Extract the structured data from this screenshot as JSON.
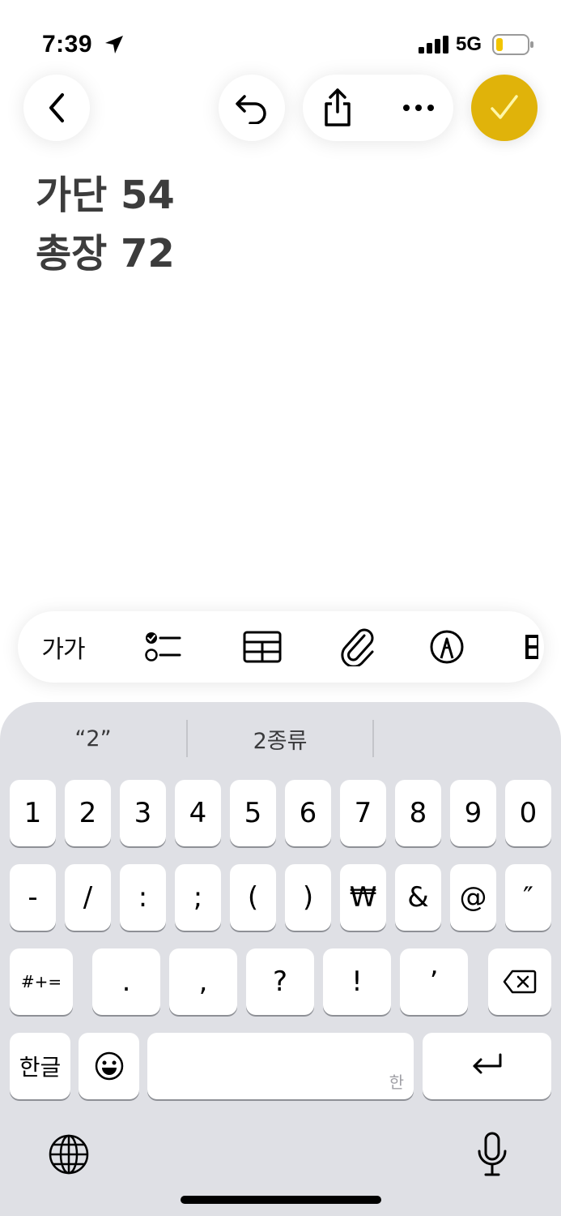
{
  "status_bar": {
    "time": "7:39",
    "network": "5G",
    "icons": [
      "location-arrow-icon",
      "signal-bars-icon",
      "battery-low-icon"
    ]
  },
  "toolbar": {
    "buttons": [
      "back-icon",
      "undo-icon",
      "share-icon",
      "more-icon",
      "checkmark-icon"
    ],
    "accent_color": "#e0b30a"
  },
  "note": {
    "lines": [
      "가단 54",
      "총장 72"
    ]
  },
  "format_bar": {
    "text_style_label": "가가",
    "icons": [
      "checklist-icon",
      "table-icon",
      "paperclip-icon",
      "markup-pen-icon",
      "partial-icon"
    ]
  },
  "keyboard": {
    "suggestions": [
      "“2”",
      "2종류",
      ""
    ],
    "row1": [
      "1",
      "2",
      "3",
      "4",
      "5",
      "6",
      "7",
      "8",
      "9",
      "0"
    ],
    "row2": [
      "-",
      "/",
      ":",
      ";",
      "(",
      ")",
      "₩",
      "&",
      "@",
      "″"
    ],
    "row3": {
      "symbols_label": "#+=",
      "keys": [
        ".",
        ",",
        "?",
        "!",
        "’"
      ]
    },
    "row4": {
      "language_label": "한글",
      "space_hint": "한"
    }
  }
}
